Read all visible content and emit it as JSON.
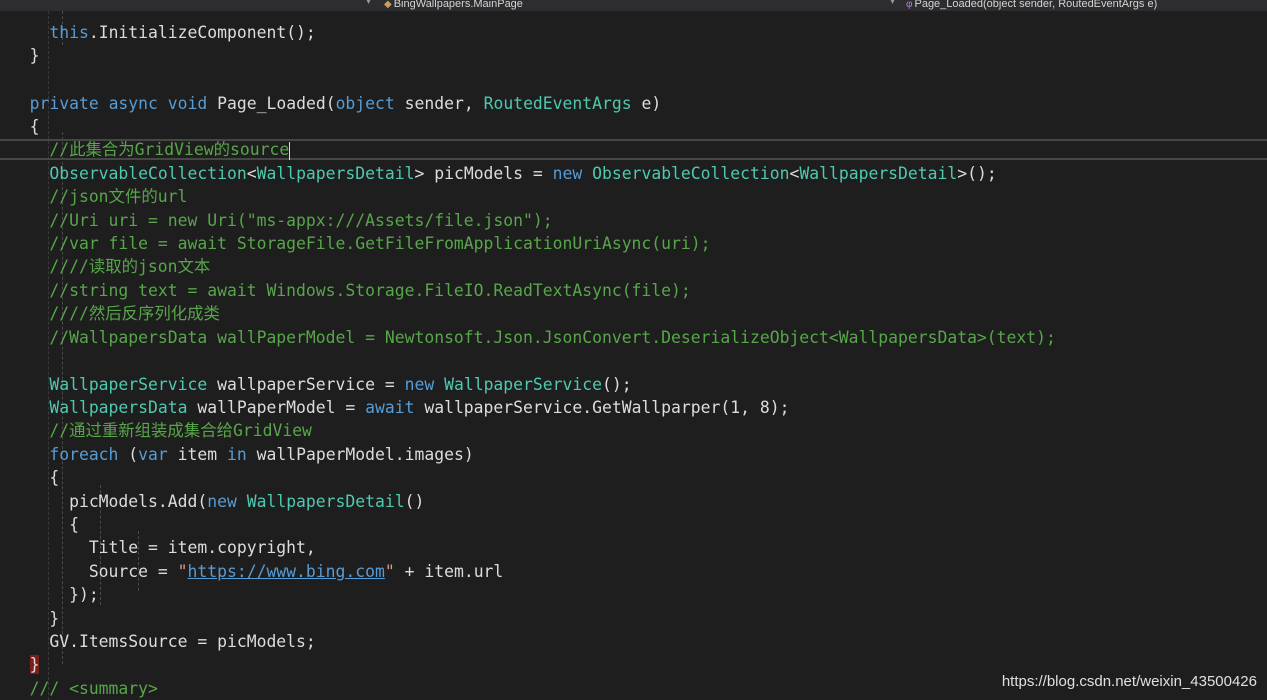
{
  "navbar": {
    "class_path": "BingWallpapers.MainPage",
    "member": "Page_Loaded(object sender, RoutedEventArgs e)"
  },
  "code": {
    "l1_this": "this",
    "l1_rest": ".InitializeComponent();",
    "l2": "}",
    "l4_private": "private",
    "l4_async": "async",
    "l4_void": "void",
    "l4_name": "Page_Loaded(",
    "l4_object": "object",
    "l4_sender": " sender, ",
    "l4_type": "RoutedEventArgs",
    "l4_e": " e)",
    "l5": "{",
    "c6": "//此集合为GridView的source",
    "l7_t1": "ObservableCollection",
    "l7_lt": "<",
    "l7_t2": "WallpapersDetail",
    "l7_mid": "> picModels = ",
    "l7_new": "new",
    "l7_t3": "ObservableCollection",
    "l7_lt2": "<",
    "l7_t4": "WallpapersDetail",
    "l7_end": ">();",
    "c8": "//json文件的url",
    "c9": "//Uri uri = new Uri(\"ms-appx:///Assets/file.json\");",
    "c10": "//var file = await StorageFile.GetFileFromApplicationUriAsync(uri);",
    "c11": "////读取的json文本",
    "c12": "//string text = await Windows.Storage.FileIO.ReadTextAsync(file);",
    "c13": "////然后反序列化成类",
    "c14": "//WallpapersData wallPaperModel = Newtonsoft.Json.JsonConvert.DeserializeObject<WallpapersData>(text);",
    "l16_t": "WallpaperService",
    "l16_mid": " wallpaperService = ",
    "l16_new": "new",
    "l16_t2": "WallpaperService",
    "l16_end": "();",
    "l17_t": "WallpapersData",
    "l17_mid": " wallPaperModel = ",
    "l17_await": "await",
    "l17_end": " wallpaperService.GetWallparper(1, 8);",
    "c18": "//通过重新组装成集合给GridView",
    "l19_foreach": "foreach",
    "l19_p": " (",
    "l19_var": "var",
    "l19_item": " item ",
    "l19_in": "in",
    "l19_end": " wallPaperModel.images)",
    "l20": "{",
    "l21_a": "picModels.Add(",
    "l21_new": "new",
    "l21_t": "WallpapersDetail",
    "l21_end": "()",
    "l22": "{",
    "l23": "Title = item.copyright,",
    "l24_a": "Source = ",
    "l24_q1": "\"",
    "l24_url": "https://www.bing.com",
    "l24_q2": "\"",
    "l24_end": " + item.url",
    "l25": "});",
    "l26": "}",
    "l27": "GV.ItemsSource = picModels;",
    "l28": "}",
    "l29": "/// <summary>"
  },
  "watermark": "https://blog.csdn.net/weixin_43500426",
  "colors": {
    "background": "#1e1e1e",
    "keyword": "#569cd6",
    "type": "#4ec9b0",
    "comment": "#57a64a",
    "string": "#d69d85"
  }
}
